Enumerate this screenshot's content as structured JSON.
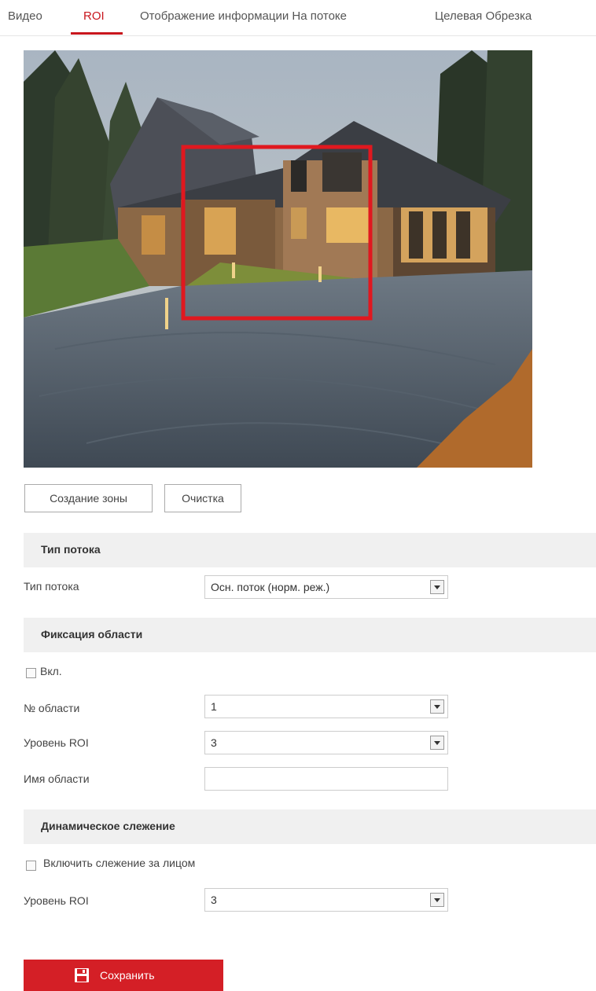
{
  "tabs": [
    {
      "label": "Видео"
    },
    {
      "label": "ROI"
    },
    {
      "label": "Отображение информации На потоке"
    },
    {
      "label": "Целевая Обрезка"
    }
  ],
  "active_tab": "ROI",
  "actions": {
    "create_zone": "Создание зоны",
    "clear": "Очистка"
  },
  "stream_type_section": {
    "title": "Тип потока",
    "label": "Тип потока",
    "value": "Осн. поток (норм. реж.)"
  },
  "fixed_region_section": {
    "title": "Фиксация области",
    "enable_label": "Вкл.",
    "enabled": false,
    "region_no_label": "№ области",
    "region_no_value": "1",
    "roi_level_label": "Уровень ROI",
    "roi_level_value": "3",
    "region_name_label": "Имя области",
    "region_name_value": ""
  },
  "dynamic_tracking_section": {
    "title": "Динамическое слежение",
    "enable_face_label": "Включить слежение за лицом",
    "enabled": false,
    "roi_level_label": "Уровень ROI",
    "roi_level_value": "3"
  },
  "save_button": "Сохранить",
  "colors": {
    "accent": "#c8161d",
    "save_bg": "#d41f26",
    "roi_box": "#e0181f",
    "section_bg": "#f0f0f0"
  },
  "icons": {
    "save": "floppy-disk-icon",
    "select_arrow": "chevron-down-icon"
  }
}
